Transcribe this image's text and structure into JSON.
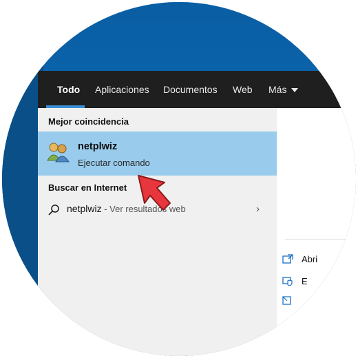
{
  "tabs": [
    {
      "label": "Todo"
    },
    {
      "label": "Aplicaciones"
    },
    {
      "label": "Documentos"
    },
    {
      "label": "Web"
    },
    {
      "label": "Más"
    }
  ],
  "best_match": {
    "section": "Mejor coincidencia",
    "title": "netplwiz",
    "subtitle": "Ejecutar comando",
    "icon": "users-icon"
  },
  "internet": {
    "section": "Buscar en Internet",
    "query": "netplwiz",
    "suffix": " - Ver resultados web"
  },
  "right_panel": {
    "items": [
      {
        "label": "Abri",
        "icon": "open-icon"
      },
      {
        "label": "E",
        "icon": "shield-icon"
      },
      {
        "label": "",
        "icon": "folder-icon"
      }
    ]
  },
  "colors": {
    "accent": "#3a8fd6",
    "highlight": "#99ccec",
    "topbar": "#1f1f1f",
    "arrow": "#e8373c"
  }
}
